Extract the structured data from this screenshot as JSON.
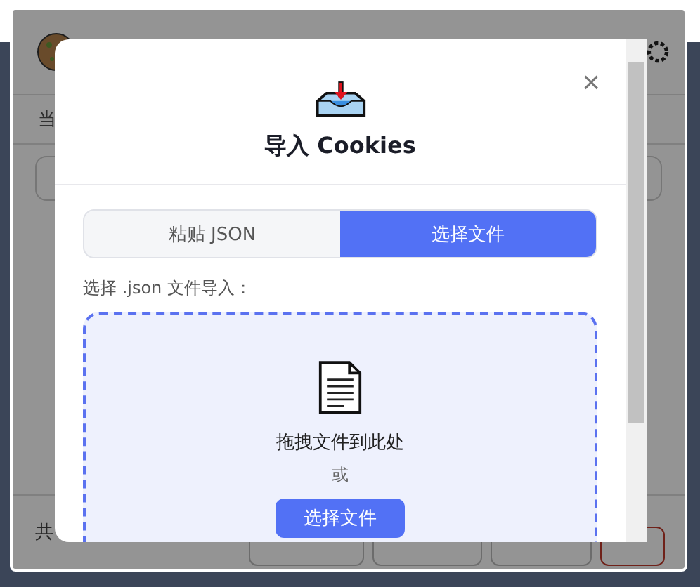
{
  "backdrop": {
    "current_label": "当",
    "footer_count": "共"
  },
  "dialog": {
    "title": "导入 Cookies",
    "close": "×",
    "tabs": [
      {
        "label": "粘贴 JSON",
        "selected": false
      },
      {
        "label": "选择文件",
        "selected": true
      }
    ],
    "hint": "选择 .json 文件导入：",
    "dropzone": {
      "text": "拖拽文件到此处",
      "or": "或",
      "button": "选择文件"
    }
  }
}
